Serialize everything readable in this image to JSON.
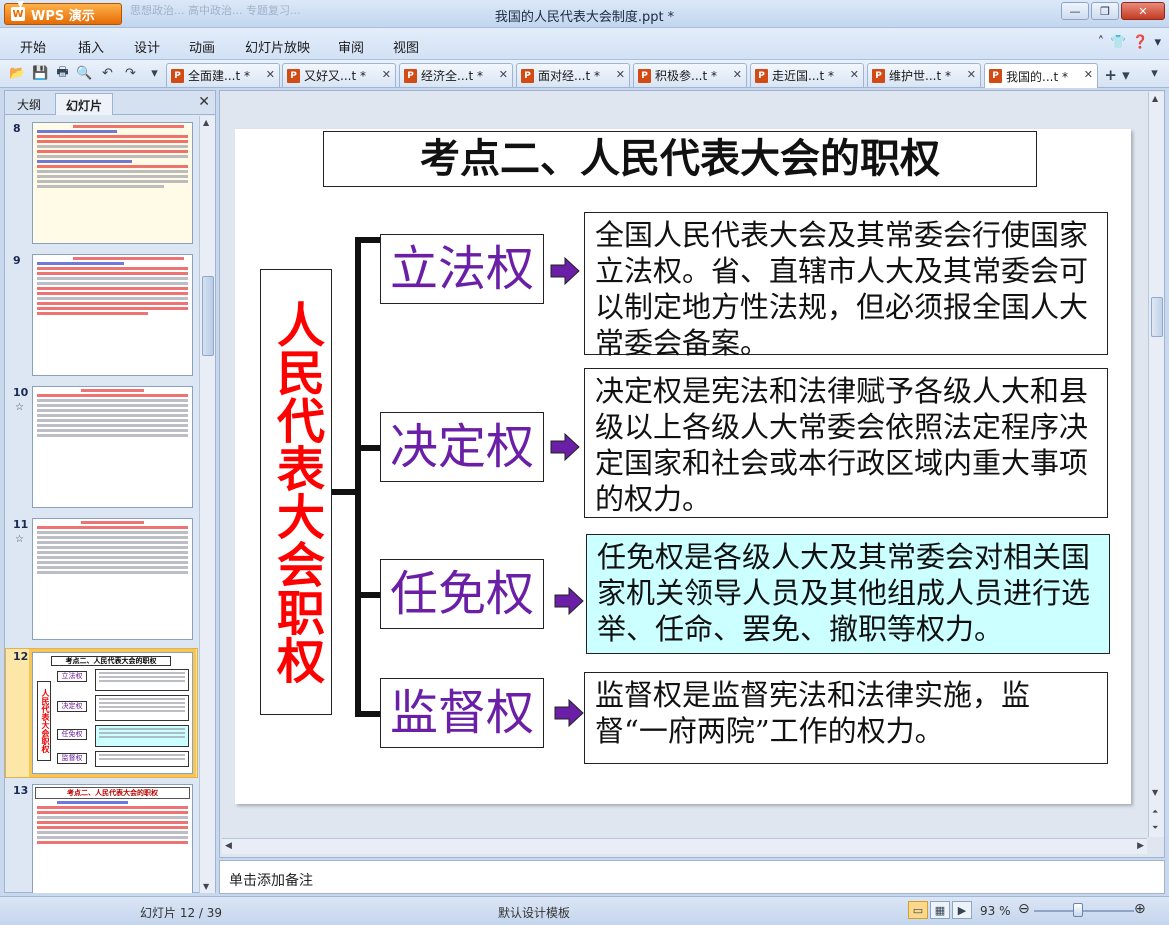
{
  "app": {
    "menu_label": "WPS 演示",
    "window_title": "我国的人民代表大会制度.ppt *",
    "bg_tabs_faint": "思想政治...                       高中政治...                      专题复习..."
  },
  "menu": [
    "开始",
    "插入",
    "设计",
    "动画",
    "幻灯片放映",
    "审阅",
    "视图"
  ],
  "doc_tabs": [
    {
      "label": "全面建...t *",
      "active": false
    },
    {
      "label": "又好又...t *",
      "active": false
    },
    {
      "label": "经济全...t *",
      "active": false
    },
    {
      "label": "面对经...t *",
      "active": false
    },
    {
      "label": "积极参...t *",
      "active": false
    },
    {
      "label": "走近国...t *",
      "active": false
    },
    {
      "label": "维护世...t *",
      "active": false
    },
    {
      "label": "我国的...t *",
      "active": true
    }
  ],
  "left_panel": {
    "tabs": [
      "大纲",
      "幻灯片"
    ],
    "active_tab": "幻灯片",
    "slide_numbers": [
      "8",
      "9",
      "10",
      "11",
      "12",
      "13"
    ],
    "selected_slide": "12",
    "thumb12": {
      "title": "考点二、人民代表大会的职权",
      "vertical": "人民代表大会职权",
      "powers": [
        "立法权",
        "决定权",
        "任免权",
        "监督权"
      ]
    },
    "thumb13_title": "考点二、人民代表大会的职权"
  },
  "slide": {
    "title": "考点二、人民代表大会的职权",
    "vertical_title": "人民代表大会职权",
    "powers": [
      {
        "label": "立法权",
        "desc": "全国人民代表大会及其常委会行使国家立法权。省、直辖市人大及其常委会可以制定地方性法规，但必须报全国人大常委会备案。"
      },
      {
        "label": "决定权",
        "desc": "决定权是宪法和法律赋予各级人大和县级以上各级人大常委会依照法定程序决定国家和社会或本行政区域内重大事项的权力。"
      },
      {
        "label": "任免权",
        "desc": "任免权是各级人大及其常委会对相关国家机关领导人员及其他组成人员进行选举、任命、罢免、撤职等权力。"
      },
      {
        "label": "监督权",
        "desc": "监督权是监督宪法和法律实施，监督“一府两院”工作的权力。"
      }
    ],
    "colors": {
      "vertical": "#ff0000",
      "powers": "#6a1fa6",
      "arrow": "#6a1fa6",
      "highlight": "#ccffff"
    }
  },
  "notes_placeholder": "单击添加备注",
  "status": {
    "slide_counter": "幻灯片 12 / 39",
    "template": "默认设计模板",
    "zoom": "93 %"
  }
}
